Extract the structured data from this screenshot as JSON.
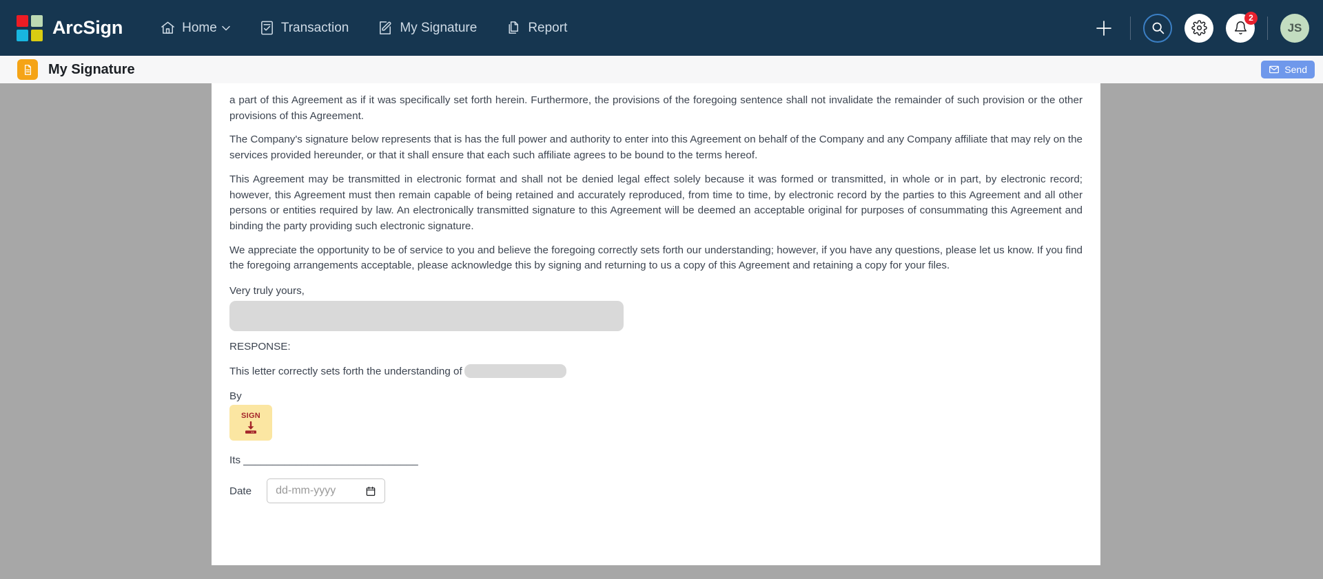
{
  "brand": {
    "name": "ArcSign",
    "logo_colors": [
      "#ed1c24",
      "#bcd9b3",
      "#18b6e0",
      "#d9cc12"
    ]
  },
  "nav": {
    "items": [
      {
        "label": "Home",
        "icon": "home-icon",
        "has_chevron": true
      },
      {
        "label": "Transaction",
        "icon": "transaction-icon",
        "has_chevron": false
      },
      {
        "label": "My Signature",
        "icon": "signature-icon",
        "has_chevron": false
      },
      {
        "label": "Report",
        "icon": "report-icon",
        "has_chevron": false
      }
    ]
  },
  "header_actions": {
    "add_label": "+",
    "search_icon": "search-icon",
    "settings_icon": "gear-icon",
    "notifications_icon": "bell-icon",
    "notification_count": "2",
    "avatar_initials": "JS"
  },
  "subheader": {
    "title": "My Signature",
    "doc_icon": "document-icon",
    "send_label": "Send",
    "send_icon": "envelope-icon",
    "accent_orange": "#f5a417",
    "send_color": "#6f98eb"
  },
  "document": {
    "paragraphs": [
      "a part of this Agreement as if it was specifically set forth herein. Furthermore, the provisions of the foregoing sentence shall not invalidate the remainder of such provision or the other provisions of this Agreement.",
      "The Company's signature below represents that is has the full power and authority to enter into this Agreement on behalf of the Company and any Company affiliate that may rely on the services provided hereunder, or that it shall ensure that each such affiliate agrees to be bound to the terms hereof.",
      "This Agreement may be transmitted in electronic format and shall not be denied legal effect solely because it was formed or transmitted, in whole or in part, by electronic record; however, this Agreement must then remain capable of being retained and accurately reproduced, from time to time, by electronic record by the parties to this Agreement and all other persons or entities required by law. An electronically transmitted signature to this Agreement will be deemed an acceptable original for purposes of consummating this Agreement and binding the party providing such electronic signature.",
      "We appreciate the opportunity to be of service to you and believe the foregoing correctly sets forth our understanding; however, if you have any questions, please let us know. If you find the foregoing arrangements acceptable, please acknowledge this by signing and returning to us a copy of this Agreement and retaining a copy for your files."
    ],
    "closing": "Very truly yours,",
    "response_label": "RESPONSE:",
    "understanding_text": "This letter correctly sets forth the understanding of",
    "by_label": "By",
    "sign_label": "SIGN",
    "sign_icon": "sign-here-icon",
    "its_line": "Its ______________________________",
    "date_label": "Date",
    "date_placeholder": "dd-mm-yyyy",
    "date_value": "",
    "calendar_icon": "calendar-icon"
  }
}
